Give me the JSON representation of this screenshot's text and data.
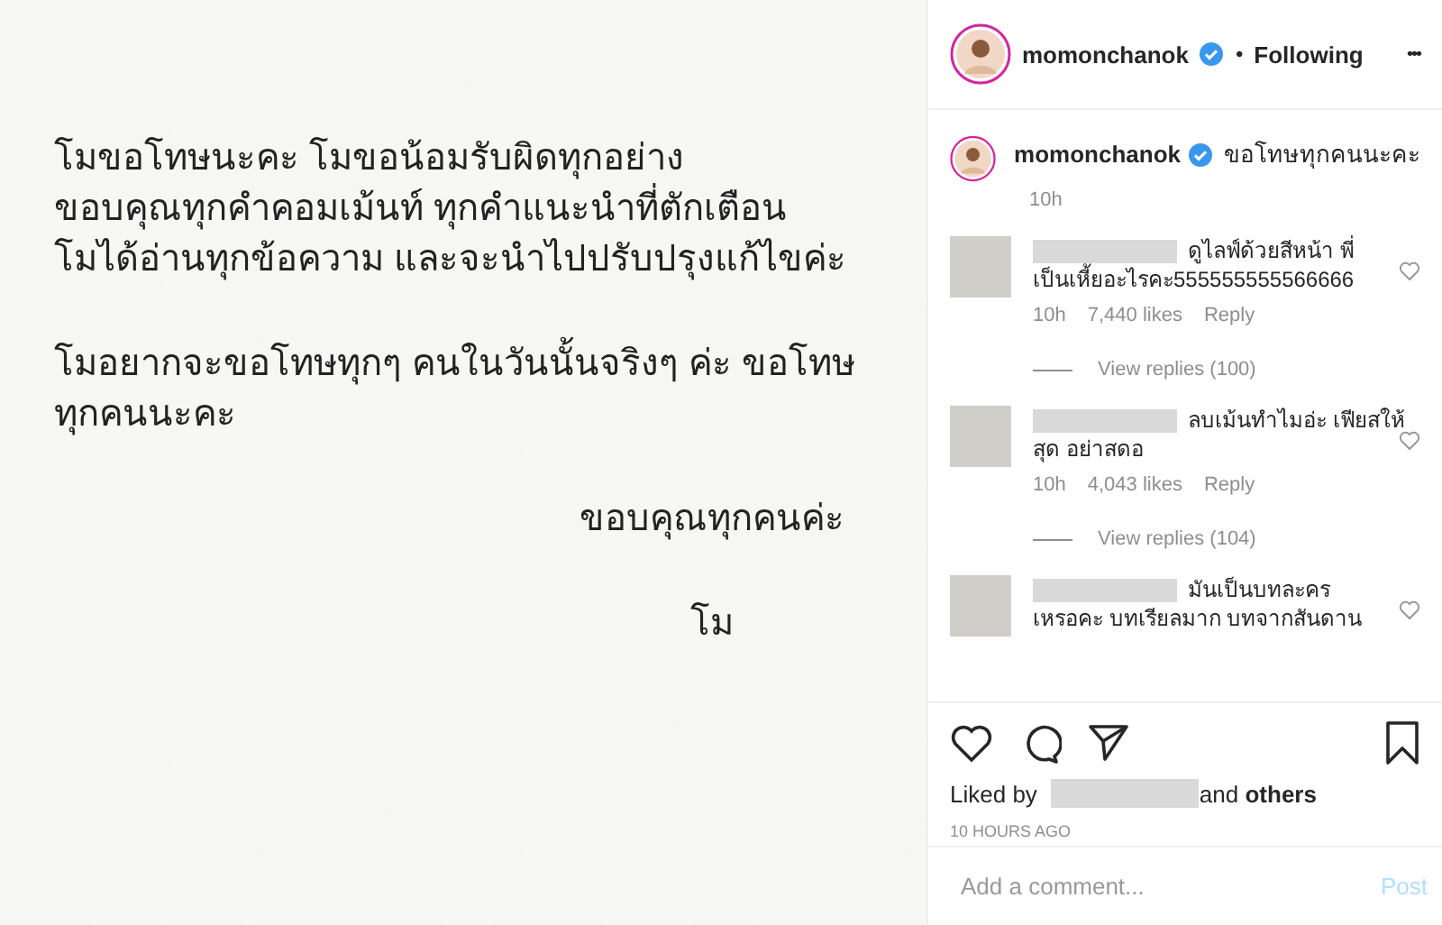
{
  "post_image": {
    "blocks": [
      {
        "kind": "body",
        "lines": [
          "โมขอโทษนะคะ โมขอน้อมรับผิดทุกอย่าง",
          "ขอบคุณทุกคำคอมเม้นท์ ทุกคำแนะนำที่ตักเตือน",
          "โมได้อ่านทุกข้อความ และจะนำไปปรับปรุงแก้ไขค่ะ"
        ]
      },
      {
        "kind": "body",
        "lines": [
          "โมอยากจะขอโทษทุกๆ คนในวันนั้นจริงๆ ค่ะ ขอโทษ",
          "ทุกคนนะคะ"
        ]
      },
      {
        "kind": "signoff",
        "lines": [
          "ขอบคุณทุกคนค่ะ"
        ]
      },
      {
        "kind": "signoff",
        "lines": [
          "โม"
        ]
      }
    ]
  },
  "header": {
    "username": "momonchanok",
    "verified": true,
    "separator": "•",
    "follow_status": "Following",
    "more": "•••"
  },
  "caption": {
    "username": "momonchanok",
    "verified": true,
    "text": "ขอโทษทุกคนนะคะ",
    "time": "10h"
  },
  "comments": [
    {
      "lines": [
        "ดูไลฟ์ด้วยสีหน้า พี่",
        "เป็นเหี้ยอะไรคะ555555555566666"
      ],
      "time": "10h",
      "likes": "7,440 likes",
      "reply": "Reply",
      "view_replies": "View replies (100)"
    },
    {
      "lines": [
        "ลบเม้นทำไมอ่ะ เฟียสให้",
        "สุด อย่าสดอ"
      ],
      "time": "10h",
      "likes": "4,043 likes",
      "reply": "Reply",
      "view_replies": "View replies (104)"
    },
    {
      "lines": [
        "มันเป็นบทละคร",
        "เหรอคะ บทเรียลมาก บทจากสันดาน"
      ]
    }
  ],
  "likes": {
    "prefix": "Liked by",
    "suffix": "and **others**"
  },
  "timestamp": "10 HOURS AGO",
  "comment_box": {
    "placeholder": "Add a comment...",
    "post": "Post"
  }
}
